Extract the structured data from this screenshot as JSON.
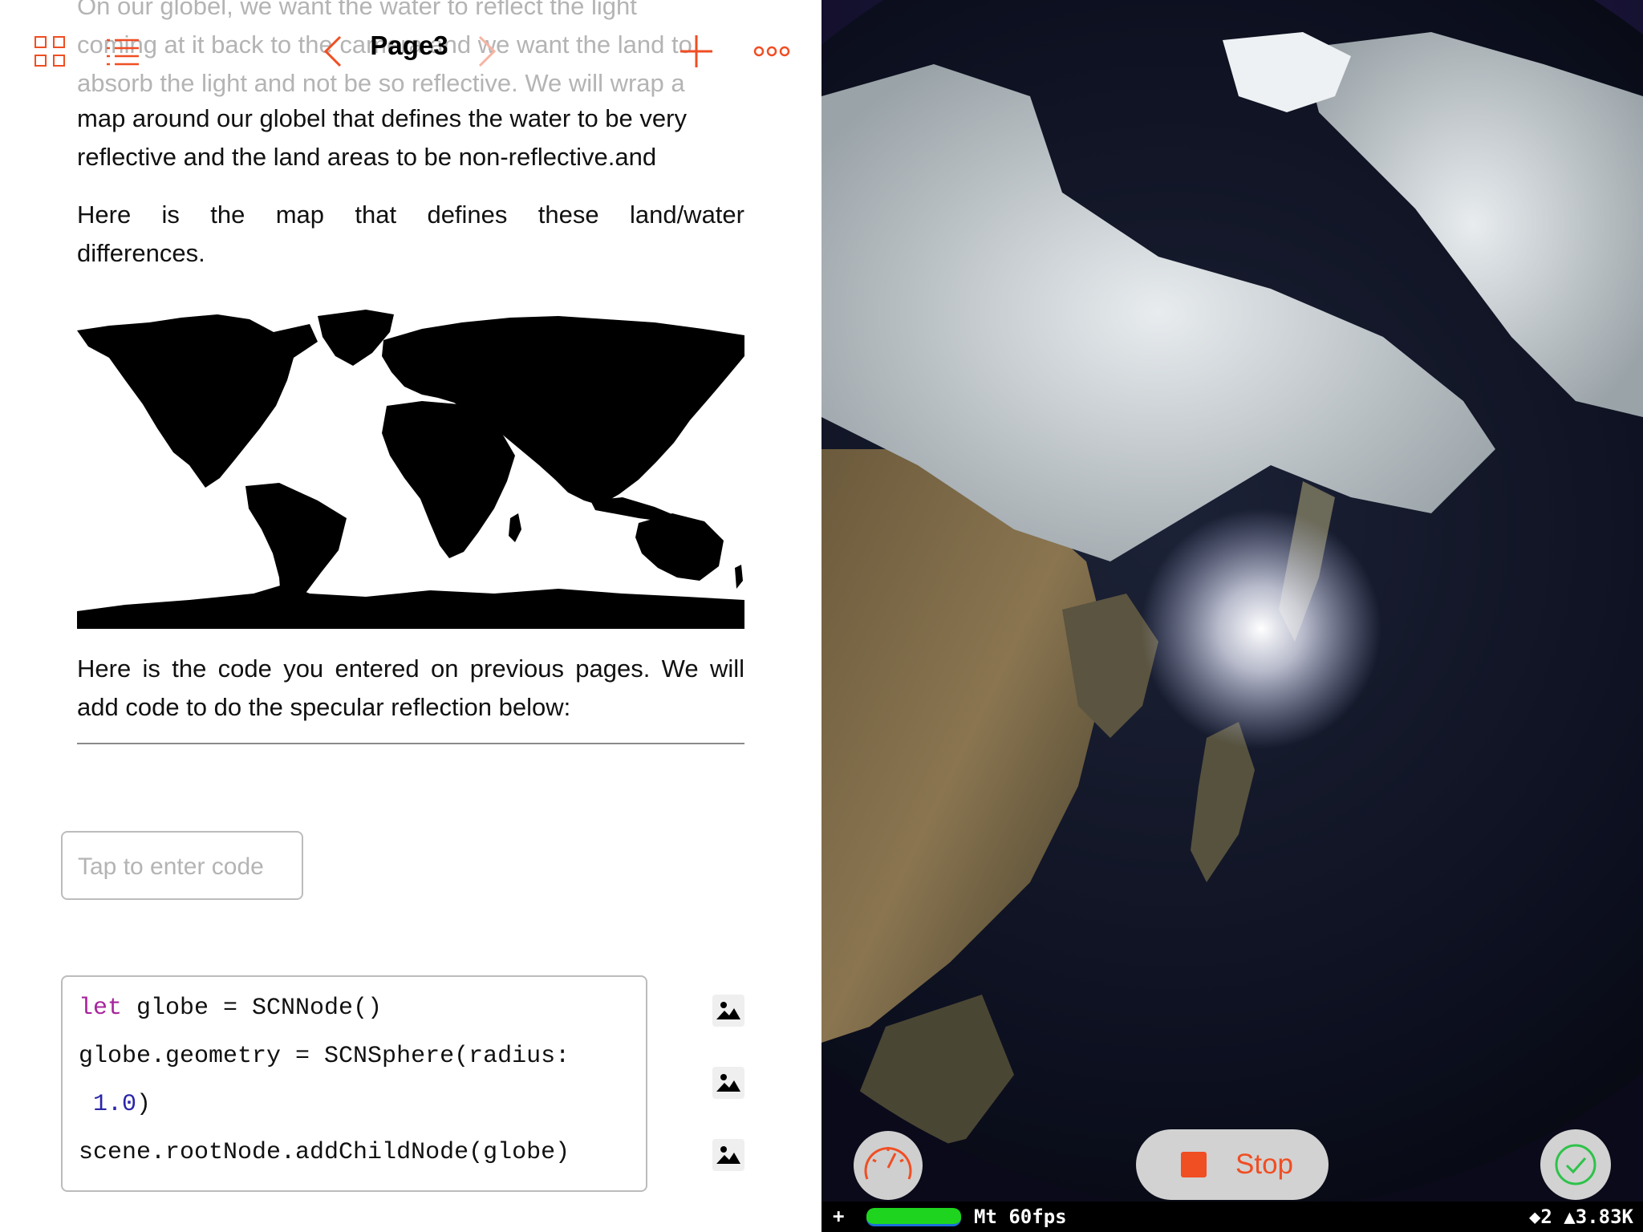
{
  "toolbar": {
    "title": "Page3"
  },
  "content": {
    "paragraph1_line1": "On our globel, we want the water to reflect the light",
    "paragraph1_line2": "coming at it back to the camera and we want the land to",
    "paragraph1_line3": "absorb the light and not be so reflective.  We will wrap a",
    "paragraph1_line4": "map around our globel that defines the water to be very",
    "paragraph1_line5": "reflective and the land areas to be non-reflective.and",
    "paragraph2": "Here is the map that defines these land/water differences.",
    "paragraph3": "Here is the code you entered on previous pages.  We will add code to do the specular reflection below:"
  },
  "code_entry": {
    "placeholder": "Tap to enter code"
  },
  "code_block": {
    "line1_keyword": "let",
    "line1_rest": " globe = SCNNode()",
    "line2": "globe.geometry = SCNSphere(radius:",
    "line3_number": "1.0",
    "line3_rest": ")",
    "line4": "scene.rootNode.addChildNode(globe)"
  },
  "liveview": {
    "stop_label": "Stop",
    "stats_plus": "+",
    "fps_label": "Mt 60fps",
    "stats_label": "◆2 ▲3.83K"
  },
  "colors": {
    "accent": "#f04e23",
    "keyword": "#a8259c",
    "number": "#2a25a8",
    "fps_bar": "#1fd41f",
    "check": "#2ec24a"
  },
  "icons": [
    "grid-view-icon",
    "list-icon",
    "chevron-left-icon",
    "chevron-right-icon",
    "plus-icon",
    "more-icon",
    "image-icon",
    "gauge-icon",
    "stop-icon",
    "checkmark-icon"
  ]
}
